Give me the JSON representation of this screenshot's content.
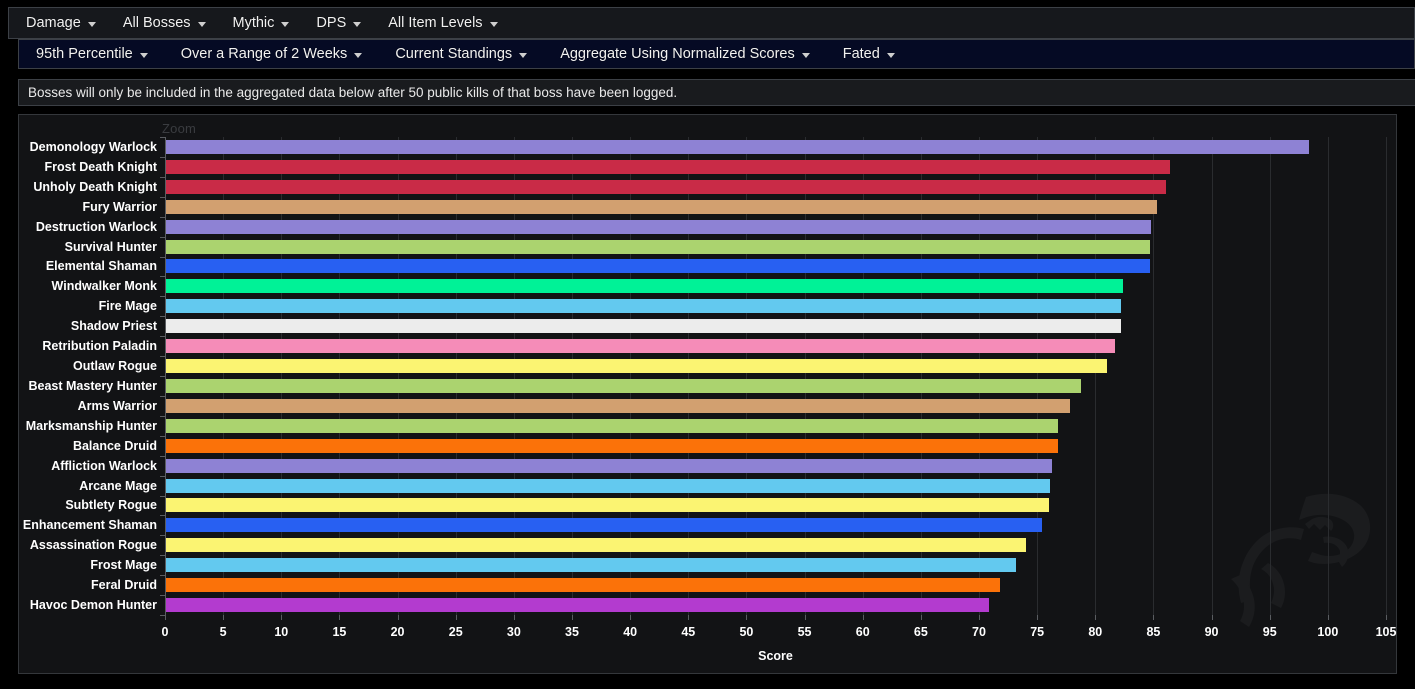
{
  "toolbars": {
    "primary": {
      "items": [
        {
          "label": "Damage",
          "icon": "chevron-down-icon"
        },
        {
          "label": "All Bosses",
          "icon": "chevron-down-icon"
        },
        {
          "label": "Mythic",
          "icon": "chevron-down-icon"
        },
        {
          "label": "DPS",
          "icon": "chevron-down-icon"
        },
        {
          "label": "All Item Levels",
          "icon": "chevron-down-icon"
        }
      ]
    },
    "secondary": {
      "items": [
        {
          "label": "95th Percentile",
          "icon": "chevron-down-icon"
        },
        {
          "label": "Over a Range of 2 Weeks",
          "icon": "chevron-down-icon"
        },
        {
          "label": "Current Standings",
          "icon": "chevron-down-icon"
        },
        {
          "label": "Aggregate Using Normalized Scores",
          "icon": "chevron-down-icon"
        },
        {
          "label": "Fated",
          "icon": "chevron-down-icon"
        }
      ]
    }
  },
  "notice": {
    "text": "Bosses will only be included in the aggregated data below after 50 public kills of that boss have been logged."
  },
  "chart_panel": {
    "zoom_label": "Zoom"
  },
  "chart_data": {
    "type": "bar",
    "orientation": "horizontal",
    "title": "",
    "xlabel": "Score",
    "ylabel": "",
    "xlim": [
      0,
      105
    ],
    "xticks": [
      0,
      5,
      10,
      15,
      20,
      25,
      30,
      35,
      40,
      45,
      50,
      55,
      60,
      65,
      70,
      75,
      80,
      85,
      90,
      95,
      100,
      105
    ],
    "grid": true,
    "legend": "none",
    "categories": [
      "Demonology Warlock",
      "Frost Death Knight",
      "Unholy Death Knight",
      "Fury Warrior",
      "Destruction Warlock",
      "Survival Hunter",
      "Elemental Shaman",
      "Windwalker Monk",
      "Fire Mage",
      "Shadow Priest",
      "Retribution Paladin",
      "Outlaw Rogue",
      "Beast Mastery Hunter",
      "Arms Warrior",
      "Marksmanship Hunter",
      "Balance Druid",
      "Affliction Warlock",
      "Arcane Mage",
      "Subtlety Rogue",
      "Enhancement Shaman",
      "Assassination Rogue",
      "Frost Mage",
      "Feral Druid",
      "Havoc Demon Hunter"
    ],
    "values": [
      98.4,
      86.4,
      86.1,
      85.3,
      84.8,
      84.7,
      84.7,
      82.4,
      82.2,
      82.2,
      81.7,
      81.0,
      78.8,
      77.8,
      76.8,
      76.8,
      76.3,
      76.1,
      76.0,
      75.4,
      74.0,
      73.2,
      71.8,
      70.9
    ],
    "colors": [
      "#8e82d4",
      "#c92b47",
      "#c92b47",
      "#d2a070",
      "#8e82d4",
      "#abd36f",
      "#2860f2",
      "#00f297",
      "#63c9ef",
      "#ececec",
      "#f58cb8",
      "#fbf472",
      "#abd36f",
      "#d2a070",
      "#abd36f",
      "#fb7209",
      "#8e82d4",
      "#63c9ef",
      "#fbf472",
      "#2860f2",
      "#fbf472",
      "#63c9ef",
      "#fb7209",
      "#b33bcf"
    ]
  }
}
